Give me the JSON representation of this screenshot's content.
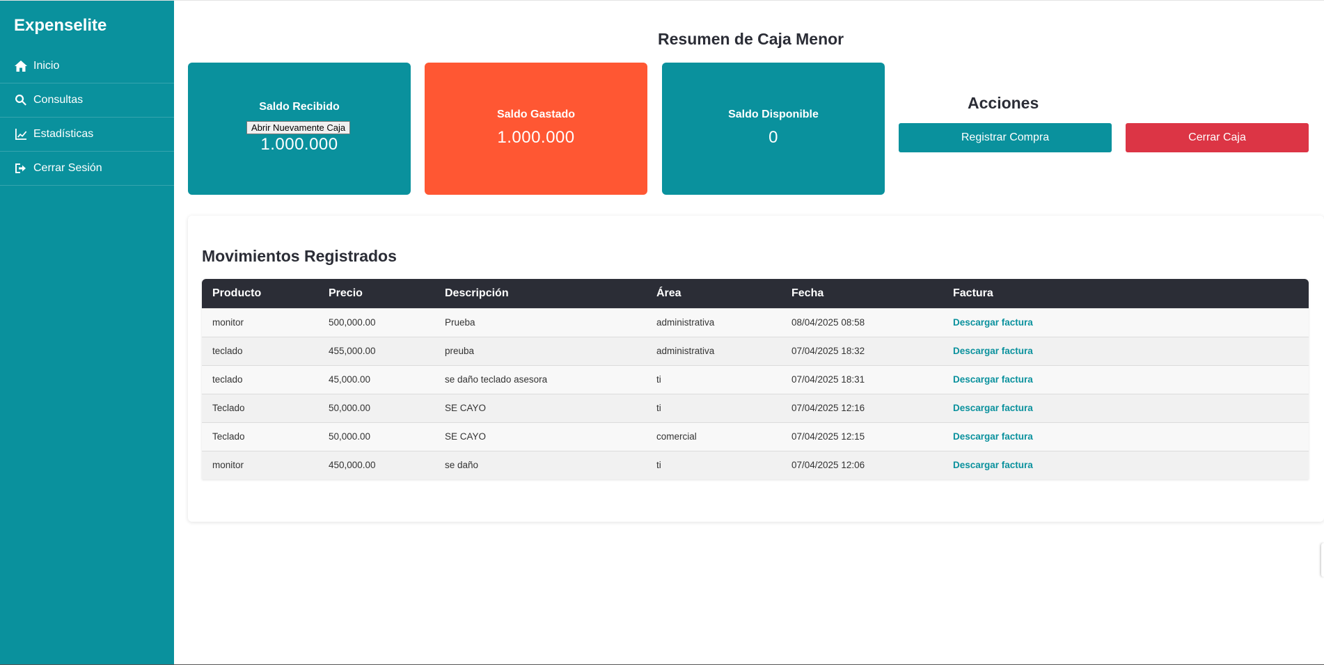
{
  "brand": "Expenselite",
  "nav": {
    "inicio": "Inicio",
    "consultas": "Consultas",
    "estadisticas": "Estadísticas",
    "cerrar_sesion": "Cerrar Sesión"
  },
  "summary_title": "Resumen de Caja Menor",
  "cards": {
    "received": {
      "title": "Saldo Recibido",
      "value": "1.000.000",
      "tooltip": "Abrir Nuevamente Caja"
    },
    "spent": {
      "title": "Saldo Gastado",
      "value": "1.000.000"
    },
    "available": {
      "title": "Saldo Disponible",
      "value": "0"
    }
  },
  "actions": {
    "title": "Acciones",
    "register_label": "Registrar Compra",
    "close_label": "Cerrar Caja"
  },
  "movements": {
    "title": "Movimientos Registrados",
    "columns": [
      "Producto",
      "Precio",
      "Descripción",
      "Área",
      "Fecha",
      "Factura"
    ],
    "rows": [
      {
        "producto": "monitor",
        "precio": "500,000.00",
        "descripcion": "Prueba",
        "area": "administrativa",
        "fecha": "08/04/2025 08:58",
        "factura": "Descargar factura"
      },
      {
        "producto": "teclado",
        "precio": "455,000.00",
        "descripcion": "preuba",
        "area": "administrativa",
        "fecha": "07/04/2025 18:32",
        "factura": "Descargar factura"
      },
      {
        "producto": "teclado",
        "precio": "45,000.00",
        "descripcion": "se daño teclado asesora",
        "area": "ti",
        "fecha": "07/04/2025 18:31",
        "factura": "Descargar factura"
      },
      {
        "producto": "Teclado",
        "precio": "50,000.00",
        "descripcion": "SE CAYO",
        "area": "ti",
        "fecha": "07/04/2025 12:16",
        "factura": "Descargar factura"
      },
      {
        "producto": "Teclado",
        "precio": "50,000.00",
        "descripcion": "SE CAYO",
        "area": "comercial",
        "fecha": "07/04/2025 12:15",
        "factura": "Descargar factura"
      },
      {
        "producto": "monitor",
        "precio": "450,000.00",
        "descripcion": "se daño",
        "area": "ti",
        "fecha": "07/04/2025 12:06",
        "factura": "Descargar factura"
      }
    ]
  },
  "colors": {
    "primary": "#0a919d",
    "spent": "#ff5733",
    "danger": "#dc3545",
    "header_dark": "#2b2d36"
  }
}
